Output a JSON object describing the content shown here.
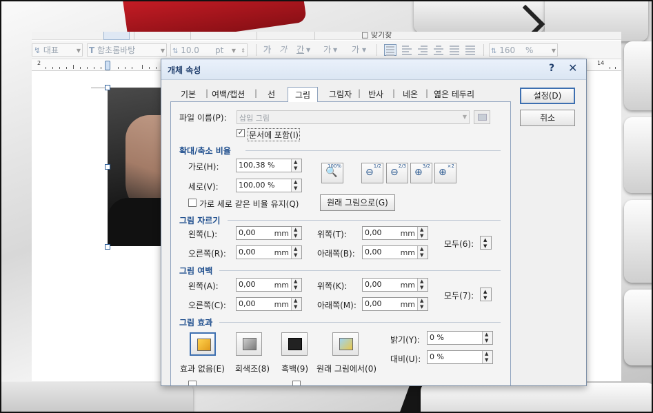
{
  "toolbar": {
    "top_fragment": "□  맞기찾",
    "style_combo": "대표",
    "font_combo": "함초롬바탕",
    "size_combo": "10.0",
    "size_unit": "pt",
    "bold": "가",
    "italic": "가",
    "underline": "간",
    "font_color": "가",
    "highlight": "가",
    "line_spacing_value": "160",
    "line_spacing_unit": "%"
  },
  "ruler": {
    "left_num": "2",
    "right_num": "14"
  },
  "dialog": {
    "title": "개체 속성",
    "help": "?",
    "close": "✕",
    "tabs": [
      "기본",
      "여백/캡션",
      "선",
      "그림",
      "그림자",
      "반사",
      "네온",
      "엷은 테두리"
    ],
    "ok": "설정(D)",
    "cancel": "취소",
    "file": {
      "label": "파일 이름(P):",
      "value": "삽입 그림",
      "embed_label": "문서에 포함(I)",
      "embed_checked": true
    },
    "scale": {
      "title": "확대/축소 비율",
      "width_label": "가로(H):",
      "width_value": "100,38 %",
      "height_label": "세로(V):",
      "height_value": "100,00 %",
      "keep_ratio_label": "가로 세로 같은 비율 유지(Q)",
      "keep_ratio_checked": false,
      "original_button": "원래 그림으로(G)",
      "zoom_buttons": [
        {
          "icon": "zoom-100-icon",
          "sup": "100%"
        },
        {
          "icon": "zoom-out-half-icon",
          "sup": "1/2"
        },
        {
          "icon": "zoom-out-twothirds-icon",
          "sup": "2/3"
        },
        {
          "icon": "zoom-in-threehalves-icon",
          "sup": "3/2"
        },
        {
          "icon": "zoom-in-double-icon",
          "sup": "×2"
        }
      ]
    },
    "crop": {
      "title": "그림 자르기",
      "left_label": "왼쪽(L):",
      "left_value": "0,00",
      "right_label": "오른쪽(R):",
      "right_value": "0,00",
      "top_label": "위쪽(T):",
      "top_value": "0,00",
      "bottom_label": "아래쪽(B):",
      "bottom_value": "0,00",
      "all_label": "모두(6):",
      "unit": "mm"
    },
    "margin": {
      "title": "그림 여백",
      "left_label": "왼쪽(A):",
      "left_value": "0,00",
      "right_label": "오른쪽(C):",
      "right_value": "0,00",
      "top_label": "위쪽(K):",
      "top_value": "0,00",
      "bottom_label": "아래쪽(M):",
      "bottom_value": "0,00",
      "all_label": "모두(7):",
      "unit": "mm"
    },
    "effect": {
      "title": "그림 효과",
      "none": "효과 없음(E)",
      "gray": "회색조(8)",
      "bw": "흑백(9)",
      "original": "원래 그림에서(0)",
      "brightness_label": "밝기(Y):",
      "brightness_value": "0 %",
      "contrast_label": "대비(U):",
      "contrast_value": "0 %"
    }
  },
  "colors": {
    "section_title": "#1c4c8c",
    "dialog_title": "#1f3d6b",
    "accent_border": "#3d6fb0"
  }
}
